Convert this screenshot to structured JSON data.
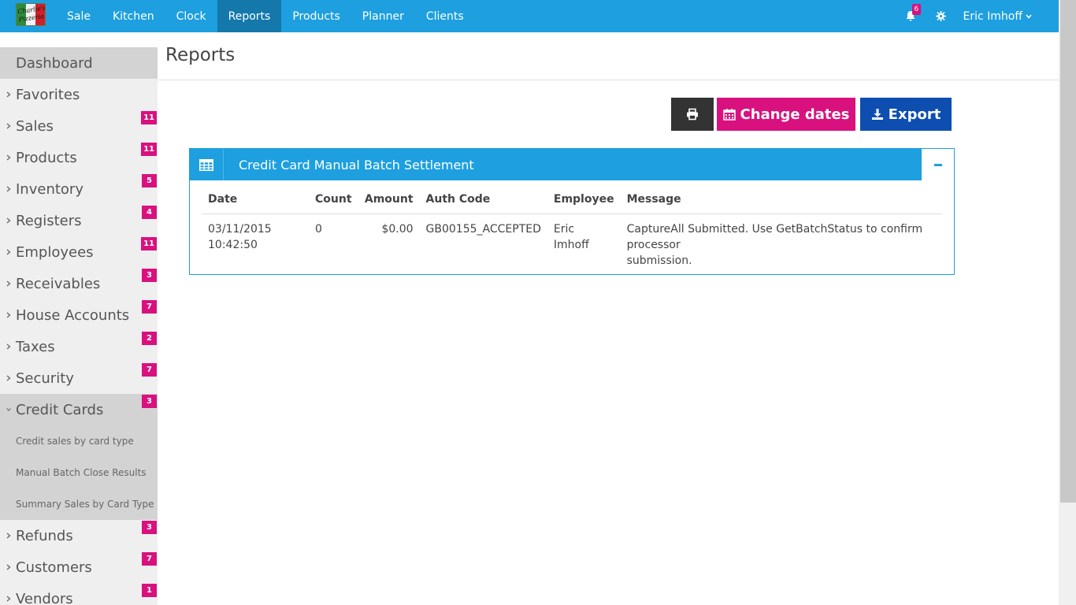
{
  "app": {
    "logo_text": "Charlie's Pizzeria",
    "nav": [
      "Sale",
      "Kitchen",
      "Clock",
      "Reports",
      "Products",
      "Planner",
      "Clients"
    ],
    "active_nav": "Reports",
    "notifications_count": "6",
    "user_name": "Eric Imhoff"
  },
  "sidebar": {
    "dashboard": "Dashboard",
    "items": [
      {
        "label": "Favorites",
        "badge": ""
      },
      {
        "label": "Sales",
        "badge": "11"
      },
      {
        "label": "Products",
        "badge": "11"
      },
      {
        "label": "Inventory",
        "badge": "5"
      },
      {
        "label": "Registers",
        "badge": "4"
      },
      {
        "label": "Employees",
        "badge": "11"
      },
      {
        "label": "Receivables",
        "badge": "3"
      },
      {
        "label": "House Accounts",
        "badge": "7"
      },
      {
        "label": "Taxes",
        "badge": "2"
      },
      {
        "label": "Security",
        "badge": "7"
      },
      {
        "label": "Credit Cards",
        "badge": "3"
      },
      {
        "label": "Refunds",
        "badge": "3"
      },
      {
        "label": "Customers",
        "badge": "7"
      },
      {
        "label": "Vendors",
        "badge": "1"
      }
    ],
    "credit_card_subitems": [
      "Credit sales by card type",
      "Manual Batch Close Results",
      "Summary Sales by Card Type"
    ]
  },
  "page": {
    "title": "Reports",
    "buttons": {
      "change_dates": "Change dates",
      "export": "Export"
    }
  },
  "panel": {
    "title": "Credit Card Manual Batch Settlement",
    "columns": [
      "Date",
      "Count",
      "Amount",
      "Auth Code",
      "Employee",
      "Message"
    ],
    "rows": [
      {
        "date_line1": "03/11/2015",
        "date_line2": "10:42:50",
        "count": "0",
        "amount": "$0.00",
        "auth_code": "GB00155_ACCEPTED",
        "employee_line1": "Eric",
        "employee_line2": "Imhoff",
        "message_line1": "CaptureAll Submitted. Use GetBatchStatus to confirm processor",
        "message_line2": "submission."
      }
    ]
  },
  "colors": {
    "primary": "#1d9fe0",
    "nav_active": "#1478ab",
    "accent_pink": "#d9117e",
    "export_blue": "#0d4eb0",
    "print_dark": "#333333"
  }
}
